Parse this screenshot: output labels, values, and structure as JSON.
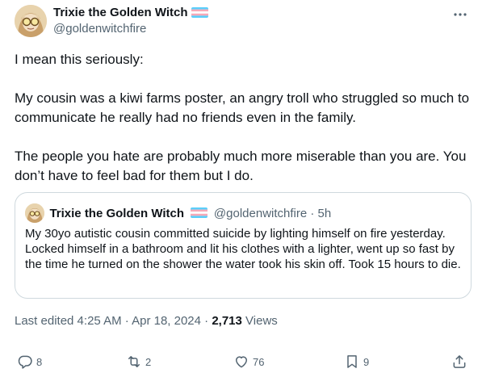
{
  "tweet": {
    "author": {
      "display_name": "Trixie the Golden Witch",
      "handle": "@goldenwitchfire",
      "avatar_icon": "avatar-witch-with-gold-glasses",
      "flag_icon": "transgender-flag-icon"
    },
    "body": {
      "p1": "I mean this seriously:",
      "p2": "My cousin was a kiwi farms poster, an angry troll who struggled so much to communicate he really had no friends even in the family.",
      "p3": "The people you hate are probably much more miserable than you are. You don’t have to feel bad for them but I do."
    },
    "quote": {
      "display_name": "Trixie the Golden Witch",
      "handle_time": "@goldenwitchfire · 5h",
      "text": "My 30yo autistic cousin committed suicide by lighting himself on fire yesterday. Locked himself in a bathroom and lit his clothes with a lighter, went up so fast by the time he turned on the shower the water took his skin off. Took 15 hours to die."
    },
    "meta": {
      "edited": "Last edited 4:25 AM · Apr 18, 2024 · ",
      "views_count": "2,713",
      "views_label": " Views"
    },
    "actions": {
      "replies": "8",
      "reposts": "2",
      "likes": "76",
      "bookmarks": "9"
    },
    "colors": {
      "text": "#0f1419",
      "secondary": "#536471",
      "border": "#cfd9de",
      "flag_blue": "#5BCEFA",
      "flag_pink": "#F5A9B8"
    }
  }
}
